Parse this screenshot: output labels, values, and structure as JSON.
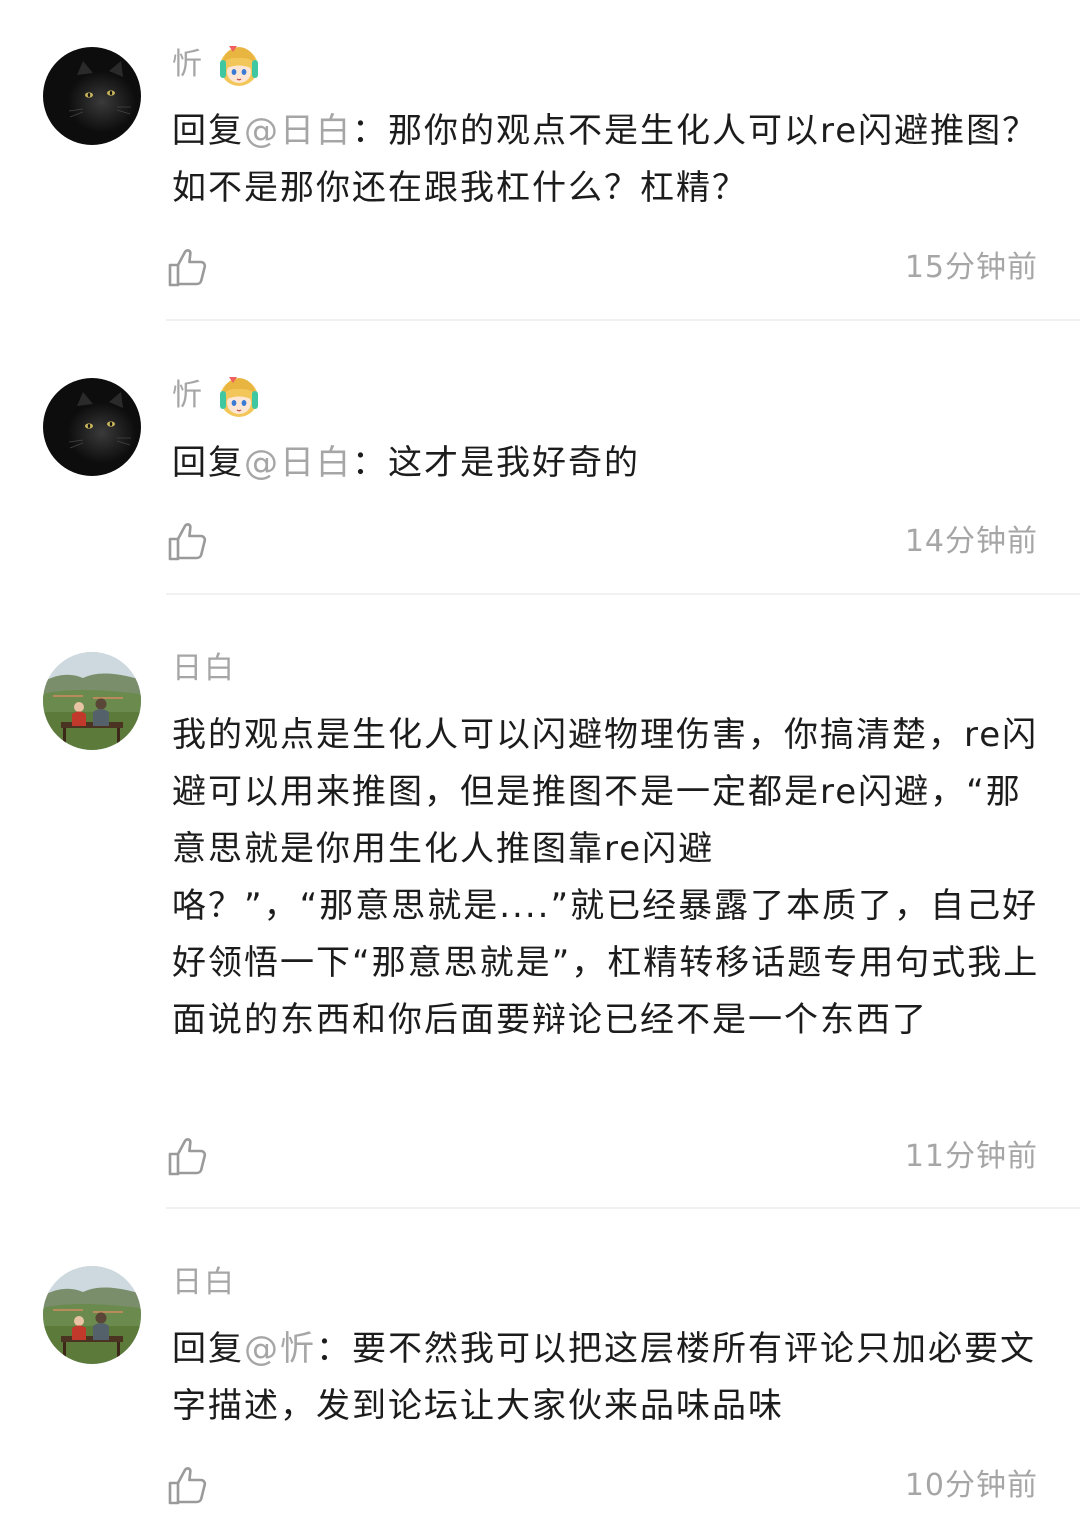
{
  "comments": [
    {
      "username": "忻",
      "avatar": "black-cat-avatar",
      "has_badge": true,
      "reply_prefix": "回复",
      "mention": "@日白",
      "separator": "：",
      "text": "那你的观点不是生化人可以re闪避推图？如不是那你还在跟我杠什么？杠精？",
      "time": "15分钟前"
    },
    {
      "username": "忻",
      "avatar": "black-cat-avatar",
      "has_badge": true,
      "reply_prefix": "回复",
      "mention": "@日白",
      "separator": "：",
      "text": "这才是我好奇的",
      "time": "14分钟前"
    },
    {
      "username": "日白",
      "avatar": "landscape-couple-avatar",
      "has_badge": false,
      "text_lines": [
        "我的观点是生化人可以闪避物理伤害，你搞清楚，re闪避可以用来推图，但是推图不是一定都是re闪避，“那意思就是你用生化人推图靠re闪避",
        "咯？”，“那意思就是....”就已经暴露了本质了，自己好好领悟一下“那意思就是”，杠精转移话题专用句式我上面说的东西和你后面要辩论已经不是一个东西了"
      ],
      "time": "11分钟前"
    },
    {
      "username": "日白",
      "avatar": "landscape-couple-avatar",
      "has_badge": false,
      "reply_prefix": "回复",
      "mention": "@忻",
      "separator": "：",
      "text": "要不然我可以把这层楼所有评论只加必要文字描述，发到论坛让大家伙来品味品味",
      "time": "10分钟前"
    }
  ],
  "icons": {
    "like": "thumbs-up-icon",
    "badge": "anime-girl-badge-icon"
  },
  "colors": {
    "muted_text": "#a6a6a6",
    "body_text": "#1c1c1c",
    "divider": "#f1f1f1",
    "background": "#ffffff"
  }
}
